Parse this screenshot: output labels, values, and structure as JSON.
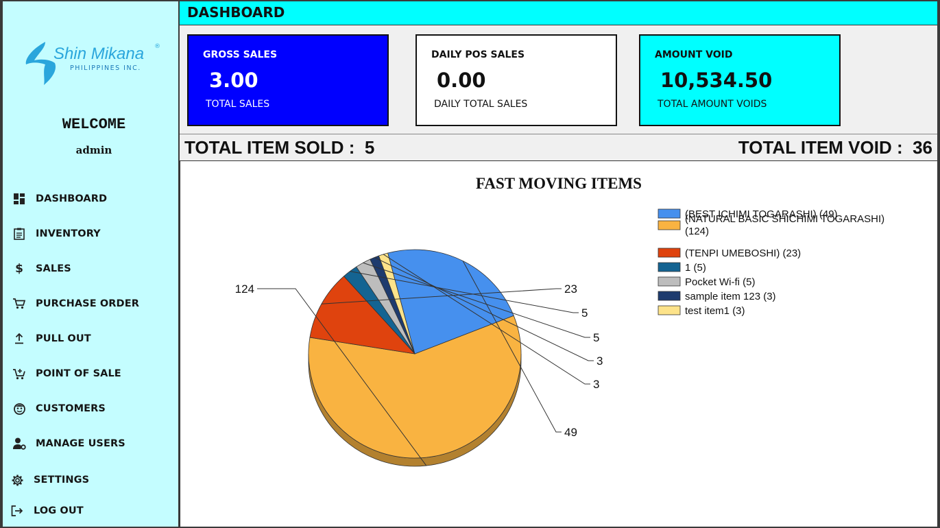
{
  "sidebar": {
    "logo": {
      "brand": "Shin Mikana",
      "sub": "PHILIPPINES INC.",
      "reg": "®"
    },
    "welcome": "WELCOME",
    "username": "admin",
    "nav": [
      {
        "label": "DASHBOARD",
        "icon": "dashboard-icon"
      },
      {
        "label": "INVENTORY",
        "icon": "clipboard-icon"
      },
      {
        "label": "SALES",
        "icon": "dollar-icon"
      },
      {
        "label": "PURCHASE ORDER",
        "icon": "cart-icon"
      },
      {
        "label": "PULL OUT",
        "icon": "upload-icon"
      },
      {
        "label": "POINT OF SALE",
        "icon": "cart-plus-icon"
      },
      {
        "label": "CUSTOMERS",
        "icon": "face-icon"
      },
      {
        "label": "MANAGE USERS",
        "icon": "user-gear-icon"
      },
      {
        "label": "SETTINGS",
        "icon": "gear-icon"
      },
      {
        "label": "LOG OUT",
        "icon": "logout-icon"
      }
    ]
  },
  "header": {
    "title": "DASHBOARD"
  },
  "cards": [
    {
      "title": "GROSS SALES",
      "value": "3.00",
      "subtitle": "TOTAL SALES",
      "bg": "#0000ff",
      "fg": "#ffffff"
    },
    {
      "title": "DAILY POS SALES",
      "value": "0.00",
      "subtitle": "DAILY TOTAL SALES",
      "bg": "#ffffff",
      "fg": "#111111"
    },
    {
      "title": "AMOUNT VOID",
      "value": "10,534.50",
      "subtitle": "TOTAL AMOUNT VOIDS",
      "bg": "#00ffff",
      "fg": "#111111"
    }
  ],
  "totals": {
    "sold_label": "TOTAL ITEM SOLD :",
    "sold_value": "5",
    "void_label": "TOTAL ITEM VOID :",
    "void_value": "36"
  },
  "chart_data": {
    "type": "pie",
    "title": "FAST MOVING ITEMS",
    "legend_position": "top-right",
    "slices": [
      {
        "label": "(BEST ICHIMI TOGARASHI) (49)",
        "value": 49,
        "color": "#4690ee"
      },
      {
        "label": "(NATURAL BASIC SHICHIMI TOGARASHI) (124)",
        "value": 124,
        "color": "#f9b341"
      },
      {
        "label": "(TENPI UMEBOSHI) (23)",
        "value": 23,
        "color": "#df430e"
      },
      {
        "label": "1 (5)",
        "value": 5,
        "color": "#146492"
      },
      {
        "label": "Pocket Wi-fi (5)",
        "value": 5,
        "color": "#bdbdbd"
      },
      {
        "label": "sample item 123 (3)",
        "value": 3,
        "color": "#1e3b6e"
      },
      {
        "label": "test item1 (3)",
        "value": 3,
        "color": "#fde38a"
      }
    ],
    "data_labels": [
      "49",
      "124",
      "23",
      "5",
      "5",
      "3",
      "3"
    ]
  }
}
